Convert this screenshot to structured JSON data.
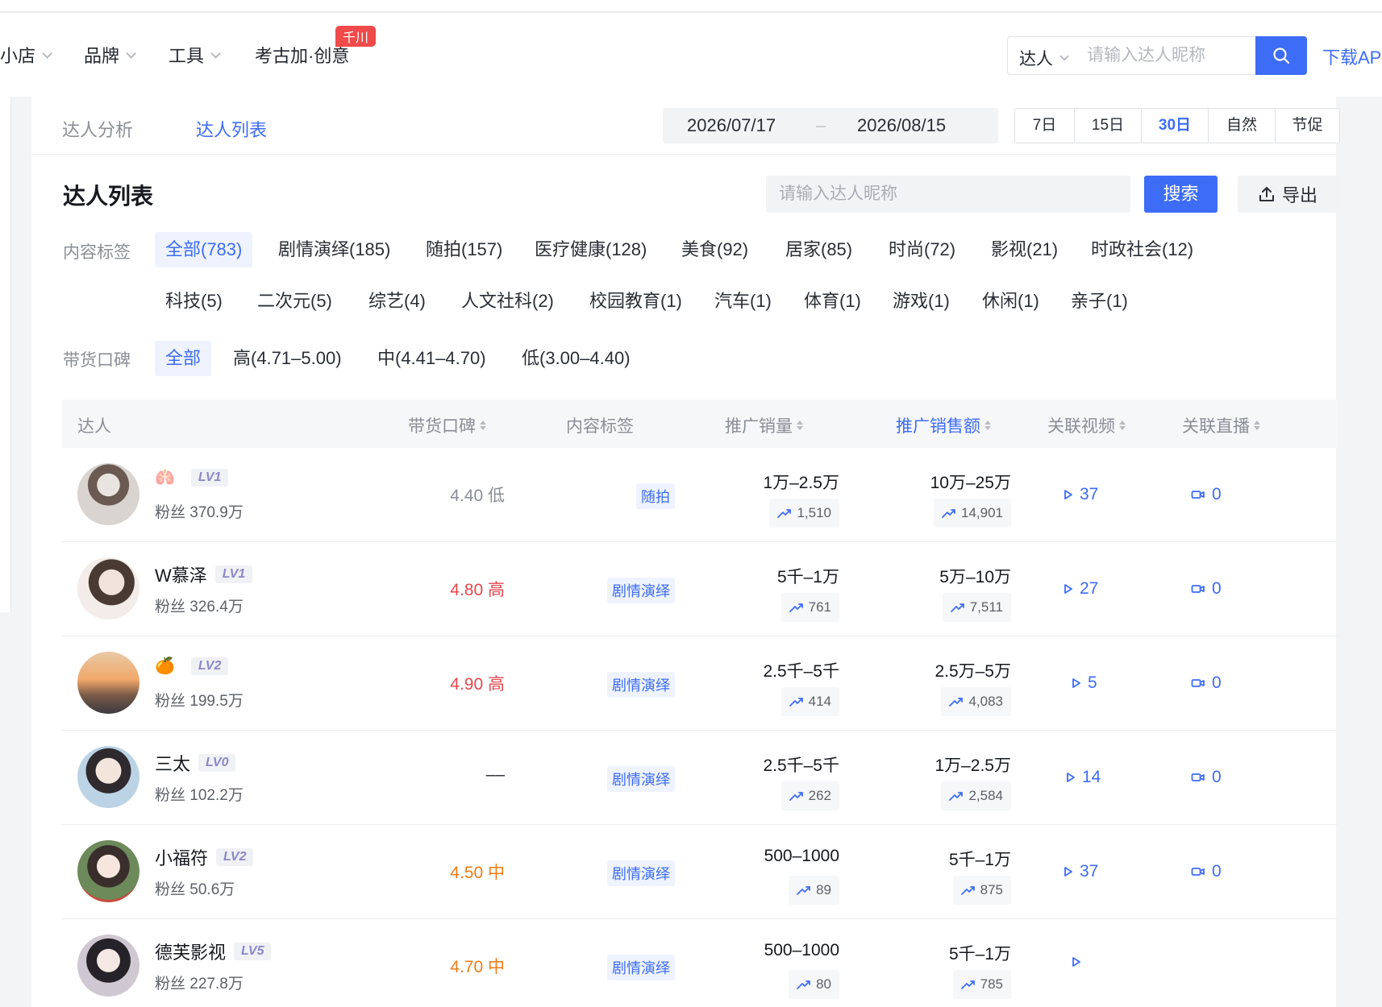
{
  "nav": {
    "items": [
      "小店",
      "品牌",
      "工具",
      "考古加·创意"
    ],
    "badge": "千川",
    "search_type": "达人",
    "search_placeholder": "请输入达人昵称",
    "download": "下载AP"
  },
  "subnav": {
    "tabs": [
      "达人分析",
      "达人列表"
    ],
    "date_start": "2026/07/17",
    "date_sep": "–",
    "date_end": "2026/08/15",
    "quick": [
      "7日",
      "15日",
      "30日",
      "自然",
      "节促"
    ]
  },
  "main": {
    "title": "达人列表",
    "search_placeholder": "请输入达人昵称",
    "search_btn": "搜索",
    "export_btn": "导出"
  },
  "filters": {
    "content_label": "内容标签",
    "content_row1": [
      "全部(783)",
      "剧情演绎(185)",
      "随拍(157)",
      "医疗健康(128)",
      "美食(92)",
      "居家(85)",
      "时尚(72)",
      "影视(21)",
      "时政社会(12)"
    ],
    "content_row2": [
      "科技(5)",
      "二次元(5)",
      "综艺(4)",
      "人文社科(2)",
      "校园教育(1)",
      "汽车(1)",
      "体育(1)",
      "游戏(1)",
      "休闲(1)",
      "亲子(1)"
    ],
    "rating_label": "带货口碑",
    "rating_opts": [
      "全部",
      "高(4.71–5.00)",
      "中(4.41–4.70)",
      "低(3.00–4.40)"
    ]
  },
  "table": {
    "headers": [
      "达人",
      "带货口碑",
      "内容标签",
      "推广销量",
      "推广销售额",
      "关联视频",
      "关联直播"
    ],
    "rows": [
      {
        "name": "",
        "emoji": "🫁",
        "lv": "LV1",
        "fans": "粉丝 370.9万",
        "rating": "4.40 低",
        "rating_color": "#8a8e96",
        "tag": "随拍",
        "sales": "1万–2.5万",
        "sales_trend": "1,510",
        "gmv": "10万–25万",
        "gmv_trend": "14,901",
        "videos": "37",
        "lives": "0"
      },
      {
        "name": "W慕泽",
        "emoji": "",
        "lv": "LV1",
        "fans": "粉丝 326.4万",
        "rating": "4.80 高",
        "rating_color": "#e5484d",
        "tag": "剧情演绎",
        "sales": "5千–1万",
        "sales_trend": "761",
        "gmv": "5万–10万",
        "gmv_trend": "7,511",
        "videos": "27",
        "lives": "0"
      },
      {
        "name": "",
        "emoji": "🍊",
        "lv": "LV2",
        "fans": "粉丝 199.5万",
        "rating": "4.90 高",
        "rating_color": "#e5484d",
        "tag": "剧情演绎",
        "sales": "2.5千–5千",
        "sales_trend": "414",
        "gmv": "2.5万–5万",
        "gmv_trend": "4,083",
        "videos": "5",
        "lives": "0"
      },
      {
        "name": "三太",
        "emoji": "",
        "lv": "LV0",
        "fans": "粉丝 102.2万",
        "rating": "––",
        "rating_color": "#2a2e36",
        "tag": "剧情演绎",
        "sales": "2.5千–5千",
        "sales_trend": "262",
        "gmv": "1万–2.5万",
        "gmv_trend": "2,584",
        "videos": "14",
        "lives": "0"
      },
      {
        "name": "小福符",
        "emoji": "",
        "lv": "LV2",
        "fans": "粉丝 50.6万",
        "rating": "4.50 中",
        "rating_color": "#f07b16",
        "tag": "剧情演绎",
        "sales": "500–1000",
        "sales_trend": "89",
        "gmv": "5千–1万",
        "gmv_trend": "875",
        "videos": "37",
        "lives": "0"
      },
      {
        "name": "德芙影视",
        "emoji": "",
        "lv": "LV5",
        "fans": "粉丝 227.8万",
        "rating": "4.70 中",
        "rating_color": "#f07b16",
        "tag": "剧情演绎",
        "sales": "500–1000",
        "sales_trend": "80",
        "gmv": "5千–1万",
        "gmv_trend": "785",
        "videos": "",
        "lives": ""
      }
    ]
  },
  "colors": {
    "accent": "#3d6cf6",
    "high": "#e5484d",
    "mid": "#f07b16",
    "low": "#8a8e96"
  }
}
